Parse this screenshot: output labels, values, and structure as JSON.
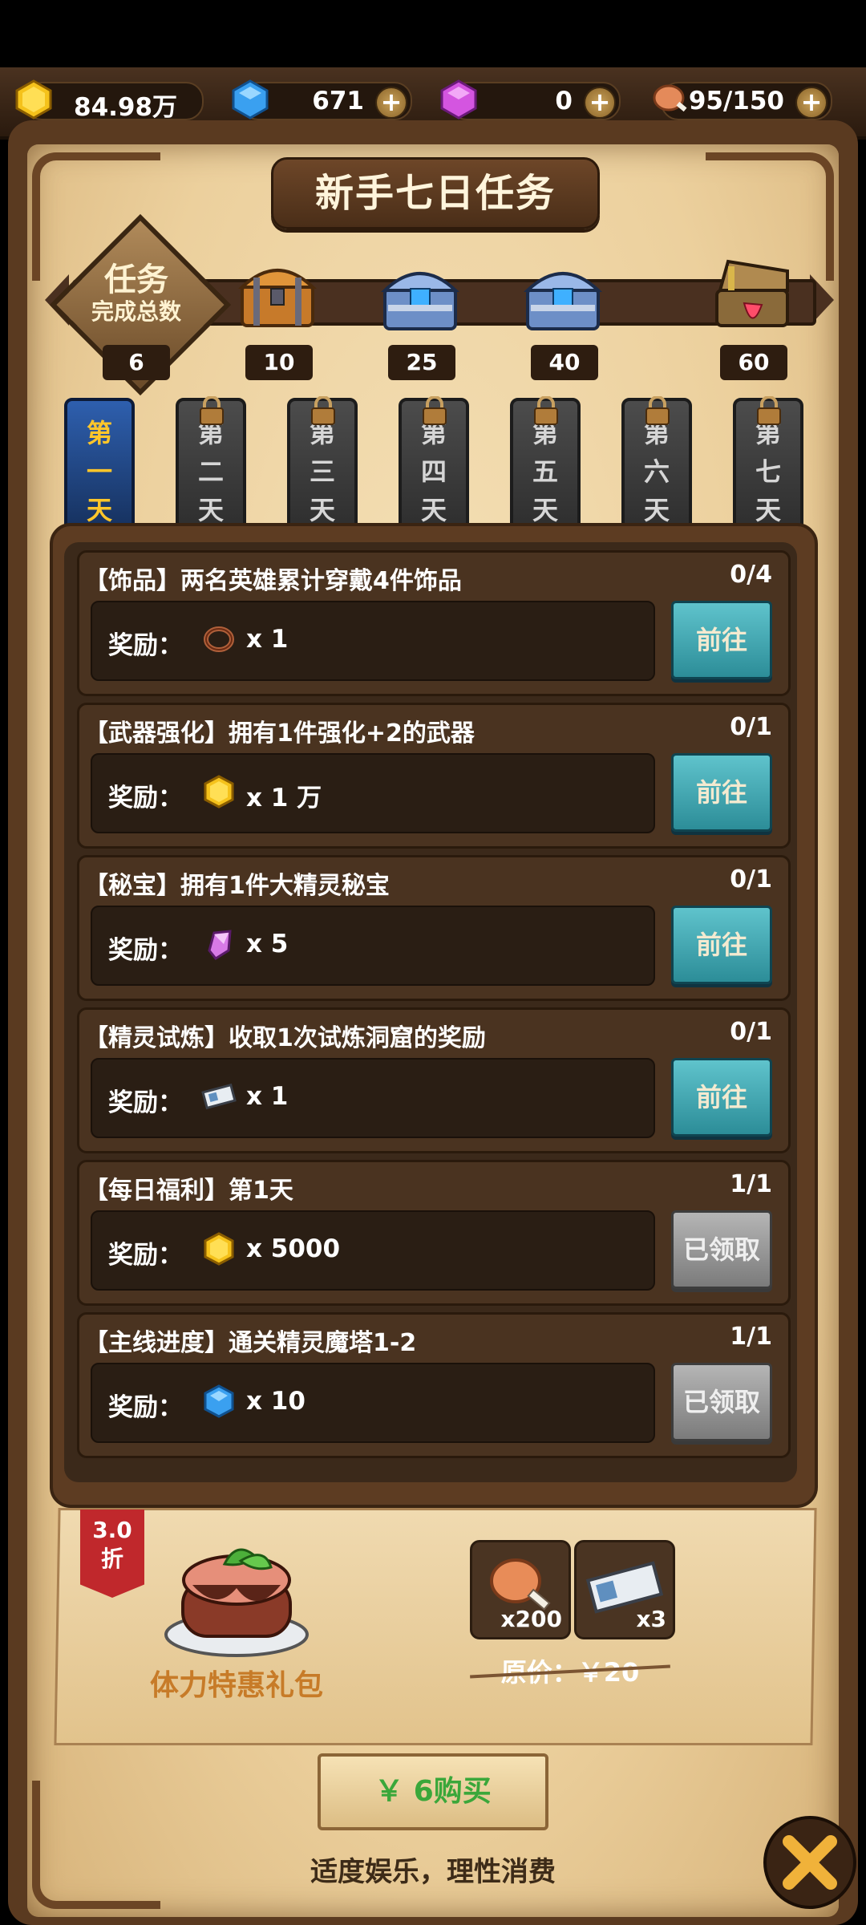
{
  "resources": {
    "gold": "84.98万",
    "diamond": "671",
    "crystal": "0",
    "stamina": "95/150"
  },
  "title": "新手七日任务",
  "progress": {
    "label_line1": "任务",
    "label_line2": "完成总数",
    "current": "6",
    "fill_fraction": 0.02,
    "milestones": [
      "10",
      "25",
      "40",
      "60"
    ]
  },
  "days": [
    {
      "line1": "第",
      "line2": "一",
      "line3": "天",
      "locked": false
    },
    {
      "line1": "第",
      "line2": "二",
      "line3": "天",
      "locked": true
    },
    {
      "line1": "第",
      "line2": "三",
      "line3": "天",
      "locked": true
    },
    {
      "line1": "第",
      "line2": "四",
      "line3": "天",
      "locked": true
    },
    {
      "line1": "第",
      "line2": "五",
      "line3": "天",
      "locked": true
    },
    {
      "line1": "第",
      "line2": "六",
      "line3": "天",
      "locked": true
    },
    {
      "line1": "第",
      "line2": "七",
      "line3": "天",
      "locked": true
    }
  ],
  "reward_label": "奖励：",
  "tasks": [
    {
      "name": "【饰品】两名英雄累计穿戴4件饰品",
      "count": "0/4",
      "reward": "x 1",
      "icon": "ring-icon",
      "button": "前往",
      "done": false
    },
    {
      "name": "【武器强化】拥有1件强化+2的武器",
      "count": "0/1",
      "reward": "x 1 万",
      "icon": "gold-icon",
      "button": "前往",
      "done": false
    },
    {
      "name": "【秘宝】拥有1件大精灵秘宝",
      "count": "0/1",
      "reward": "x 5",
      "icon": "crystal-icon",
      "button": "前往",
      "done": false
    },
    {
      "name": "【精灵试炼】收取1次试炼洞窟的奖励",
      "count": "0/1",
      "reward": "x 1",
      "icon": "ticket-icon",
      "button": "前往",
      "done": false
    },
    {
      "name": "【每日福利】第1天",
      "count": "1/1",
      "reward": "x 5000",
      "icon": "gold-icon",
      "button": "已领取",
      "done": true
    },
    {
      "name": "【主线进度】通关精灵魔塔1-2",
      "count": "1/1",
      "reward": "x 10",
      "icon": "diamond-icon",
      "button": "已领取",
      "done": true
    }
  ],
  "gift": {
    "discount_line1": "3.0",
    "discount_line2": "折",
    "name": "体力特惠礼包",
    "items": [
      {
        "icon": "meat-icon",
        "qty": "x200"
      },
      {
        "icon": "ticket-icon",
        "qty": "x3"
      }
    ],
    "original_price": "原价：￥20",
    "buy_label": "￥ 6购买"
  },
  "notice": "适度娱乐，理性消费",
  "colors": {
    "accent_blue": "#3b4fd4",
    "go_button": "#2c8d98",
    "done_button": "#7b7b7b",
    "buy_text": "#3aa73a",
    "day_active": "#ffc62a"
  }
}
